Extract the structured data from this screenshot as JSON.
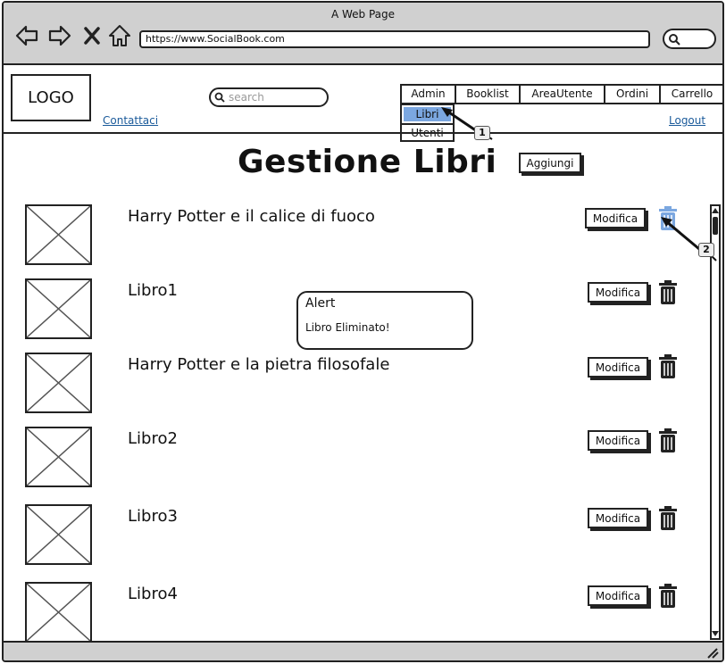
{
  "browser": {
    "title": "A Web Page",
    "url": "https://www.SocialBook.com",
    "icons": [
      "back-icon",
      "forward-icon",
      "close-icon",
      "home-icon",
      "search-icon"
    ]
  },
  "header": {
    "logo": "LOGO",
    "contact": "Contattaci",
    "search_placeholder": "search",
    "logout": "Logout"
  },
  "menu": {
    "items": [
      "Admin",
      "Booklist",
      "AreaUtente",
      "Ordini",
      "Carrello"
    ],
    "dropdown": [
      "Libri",
      "Utenti"
    ],
    "selected_dropdown": "Libri"
  },
  "main": {
    "title": "Gestione Libri",
    "add_button": "Aggiungi",
    "edit_label": "Modifica",
    "highlight_color": "#7ba7e0",
    "books": [
      {
        "title": "Harry Potter e il calice di fuoco",
        "trash_state": "active"
      },
      {
        "title": "Libro1",
        "trash_state": "normal"
      },
      {
        "title": "Harry Potter e la pietra filosofale",
        "trash_state": "normal"
      },
      {
        "title": "Libro2",
        "trash_state": "normal"
      },
      {
        "title": "Libro3",
        "trash_state": "normal"
      },
      {
        "title": "Libro4",
        "trash_state": "normal"
      }
    ]
  },
  "alert": {
    "title": "Alert",
    "message": "Libro Eliminato!"
  },
  "callouts": [
    "1",
    "2"
  ]
}
